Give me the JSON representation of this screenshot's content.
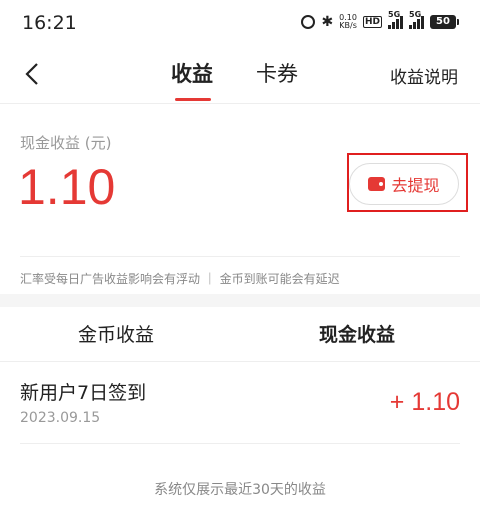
{
  "status_bar": {
    "time": "16:21",
    "speed_value": "0.10",
    "speed_unit": "KB/s",
    "hd_label": "HD",
    "signal1_label": "5G",
    "signal2_label": "5G",
    "battery": "50",
    "icons": [
      "alarm-icon",
      "bluetooth-icon"
    ]
  },
  "nav": {
    "tabs": [
      {
        "label": "收益",
        "active": true
      },
      {
        "label": "卡券",
        "active": false
      }
    ],
    "help_label": "收益说明"
  },
  "cash_card": {
    "label": "现金收益 (元)",
    "value": "1.10",
    "withdraw_label": "去提现",
    "notice": "汇率受每日广告收益影响会有浮动 ｜ 金币到账可能会有延迟"
  },
  "income_tabs": [
    {
      "label": "金币收益",
      "active": false
    },
    {
      "label": "现金收益",
      "active": true
    }
  ],
  "records": [
    {
      "title": "新用户7日签到",
      "date": "2023.09.15",
      "amount": "+ 1.10"
    }
  ],
  "footnote": "系统仅展示最近30天的收益",
  "colors": {
    "accent": "#e53935",
    "highlight_box": "#e01f1f"
  }
}
